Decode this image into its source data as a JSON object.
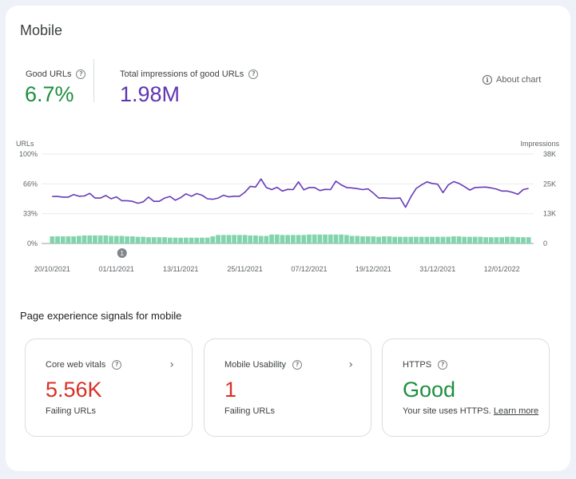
{
  "page": {
    "title": "Mobile"
  },
  "metrics": {
    "good_urls": {
      "label": "Good URLs",
      "value": "6.7%",
      "color": "#1e8e3e"
    },
    "total_impressions": {
      "label": "Total impressions of good URLs",
      "value": "1.98M",
      "color": "#5e35b1"
    }
  },
  "about_chart": {
    "label": "About chart"
  },
  "chart_data": {
    "type": "bar+line",
    "left_axis": {
      "label": "URLs",
      "ticks": [
        "100%",
        "66%",
        "33%",
        "0%"
      ],
      "range": [
        0,
        100
      ]
    },
    "right_axis": {
      "label": "Impressions",
      "ticks": [
        "38K",
        "25K",
        "13K",
        "0"
      ],
      "range": [
        0,
        38000
      ]
    },
    "x_tick_labels": [
      "20/10/2021",
      "01/11/2021",
      "13/11/2021",
      "25/11/2021",
      "07/12/2021",
      "19/12/2021",
      "31/12/2021",
      "12/01/2022"
    ],
    "start_date": "20/10/2021",
    "annotation": {
      "label": "1",
      "date": "01/11/2021"
    },
    "series": [
      {
        "name": "Good URLs (%)",
        "type": "bar",
        "axis": "left",
        "color": "#81d4ac",
        "values": [
          8,
          8,
          8,
          8,
          8,
          8.5,
          9,
          9,
          9,
          9,
          9,
          8.5,
          8.5,
          8.5,
          8,
          8,
          7.5,
          7.5,
          7,
          7,
          7,
          7,
          6.5,
          6.5,
          6.5,
          6.5,
          6.5,
          6.5,
          6.5,
          6.5,
          8,
          9.5,
          9.5,
          9.5,
          9.5,
          9.5,
          9.5,
          9,
          9,
          8.5,
          8.5,
          10,
          10,
          9.5,
          9.5,
          9.5,
          9.5,
          9.5,
          10,
          10,
          10,
          10,
          10,
          10,
          10,
          9.5,
          8.5,
          8.5,
          8,
          8,
          8,
          7.5,
          8,
          8,
          7.5,
          7.5,
          7.5,
          7.5,
          7.5,
          7.5,
          7.5,
          7.5,
          7.5,
          7.5,
          7.5,
          8,
          8,
          7.5,
          7.5,
          7.5,
          7.5,
          7,
          7,
          7,
          7,
          7.5,
          7.5,
          7,
          7,
          7
        ]
      },
      {
        "name": "Impressions",
        "type": "line",
        "axis": "right",
        "color": "#673ab7",
        "values": [
          20000,
          20000,
          19700,
          19700,
          20800,
          20100,
          20200,
          21300,
          19300,
          19300,
          20400,
          19000,
          19800,
          18200,
          18200,
          17900,
          17100,
          17700,
          19700,
          17900,
          17900,
          19300,
          20000,
          18400,
          19500,
          21100,
          20100,
          21200,
          20500,
          19000,
          18800,
          19300,
          20500,
          19800,
          20100,
          20100,
          21800,
          24300,
          24000,
          27400,
          23800,
          22900,
          23900,
          22300,
          23000,
          22900,
          26200,
          22800,
          23800,
          23800,
          22500,
          23000,
          22900,
          26500,
          24900,
          23800,
          23600,
          23300,
          22900,
          23200,
          21400,
          19300,
          19400,
          19200,
          19200,
          19300,
          15400,
          19800,
          23400,
          24900,
          26200,
          25500,
          25200,
          21600,
          24900,
          26300,
          25500,
          24200,
          22700,
          23800,
          23900,
          24000,
          23600,
          23100,
          22300,
          22300,
          21700,
          20900,
          22900,
          23400
        ]
      }
    ]
  },
  "signals": {
    "title": "Page experience signals for mobile",
    "cards": [
      {
        "title": "Core web vitals",
        "value": "5.56K",
        "value_color": "#d93025",
        "sub": "Failing URLs",
        "has_chevron": true
      },
      {
        "title": "Mobile Usability",
        "value": "1",
        "value_color": "#d93025",
        "sub": "Failing URLs",
        "has_chevron": true
      },
      {
        "title": "HTTPS",
        "value": "Good",
        "value_color": "#1e8e3e",
        "sub": "Your site uses HTTPS.",
        "link": "Learn more",
        "has_chevron": false
      }
    ]
  },
  "icons": {
    "help": "?",
    "info": "i",
    "chevron": "›"
  }
}
